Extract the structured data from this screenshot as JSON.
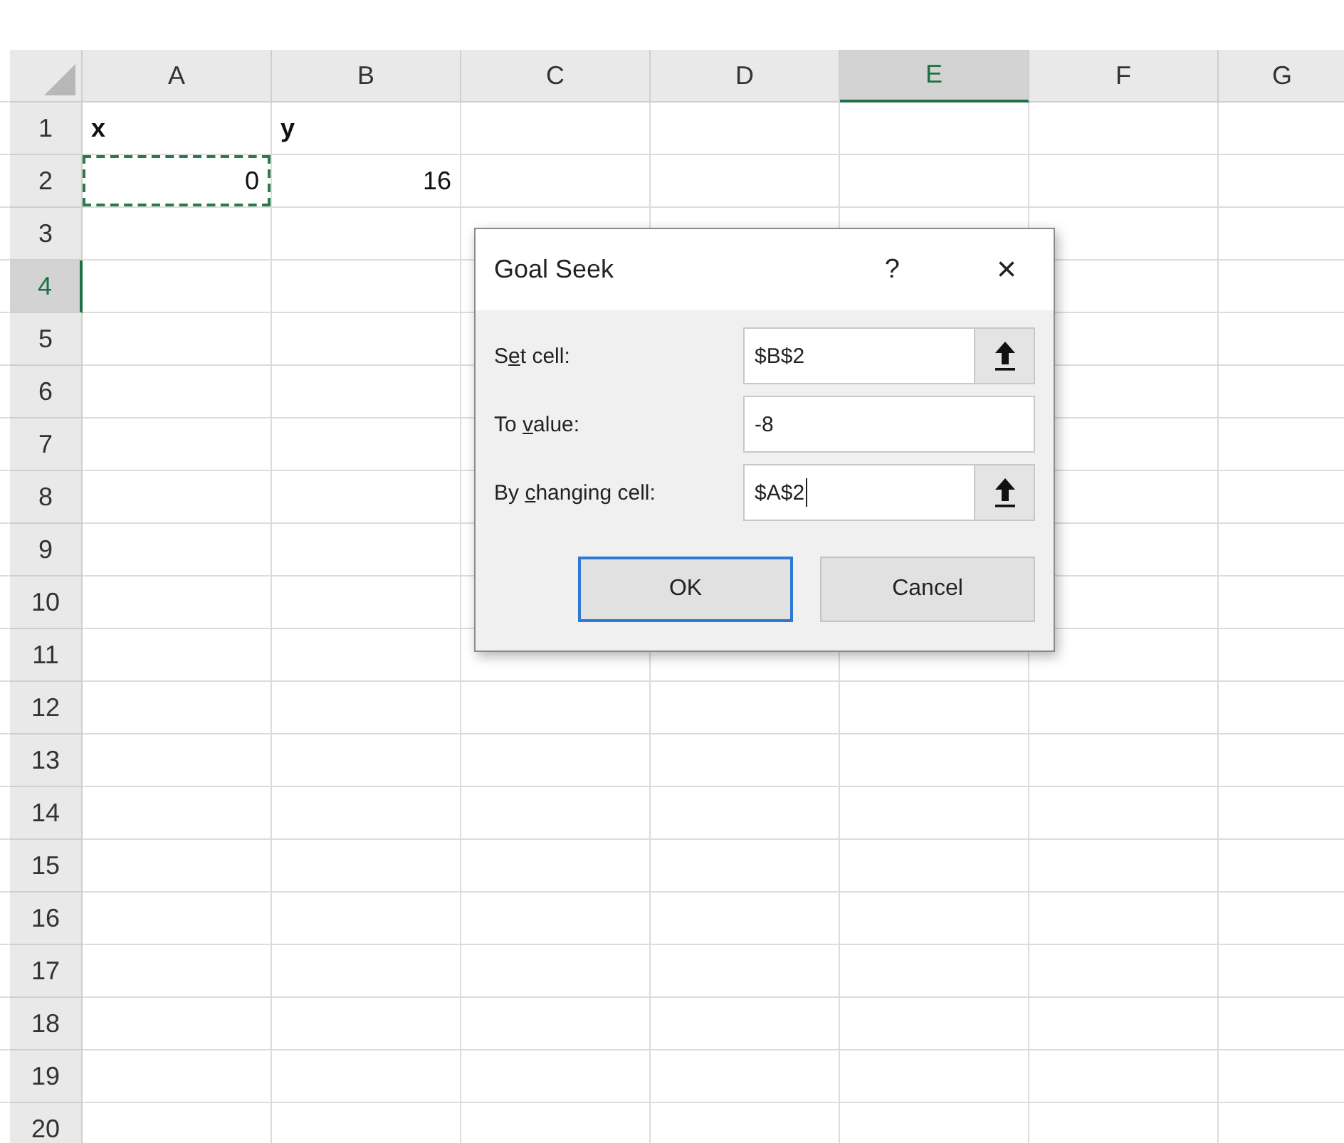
{
  "sheet": {
    "columns": [
      {
        "label": "A",
        "selected": false
      },
      {
        "label": "B",
        "selected": false
      },
      {
        "label": "C",
        "selected": false
      },
      {
        "label": "D",
        "selected": false
      },
      {
        "label": "E",
        "selected": true
      },
      {
        "label": "F",
        "selected": false
      },
      {
        "label": "G",
        "selected": false
      }
    ],
    "rows": [
      {
        "label": "1",
        "selected": false,
        "cells": [
          {
            "kind": "text",
            "text": "x",
            "bold": true
          },
          {
            "kind": "text",
            "text": "y",
            "bold": true
          }
        ]
      },
      {
        "label": "2",
        "selected": false,
        "cells": [
          {
            "kind": "number",
            "text": "0",
            "copy_marquee": true
          },
          {
            "kind": "number",
            "text": "16"
          }
        ]
      },
      {
        "label": "3",
        "selected": false
      },
      {
        "label": "4",
        "selected": true
      },
      {
        "label": "5",
        "selected": false
      },
      {
        "label": "6",
        "selected": false
      },
      {
        "label": "7",
        "selected": false
      },
      {
        "label": "8",
        "selected": false
      },
      {
        "label": "9",
        "selected": false
      },
      {
        "label": "10",
        "selected": false
      },
      {
        "label": "11",
        "selected": false
      },
      {
        "label": "12",
        "selected": false
      },
      {
        "label": "13",
        "selected": false
      },
      {
        "label": "14",
        "selected": false
      },
      {
        "label": "15",
        "selected": false
      },
      {
        "label": "16",
        "selected": false
      },
      {
        "label": "17",
        "selected": false
      },
      {
        "label": "18",
        "selected": false
      },
      {
        "label": "19",
        "selected": false
      },
      {
        "label": "20",
        "selected": false
      }
    ]
  },
  "dialog": {
    "title": "Goal Seek",
    "help": "?",
    "close": "×",
    "fields": [
      {
        "kind": "reference",
        "label": {
          "before": "S",
          "key": "e",
          "after": "t cell:"
        },
        "value": "$B$2",
        "focused": false
      },
      {
        "kind": "plain",
        "label": {
          "before": "To ",
          "key": "v",
          "after": "alue:"
        },
        "value": "-8",
        "focused": false
      },
      {
        "kind": "reference",
        "label": {
          "before": "By ",
          "key": "c",
          "after": "hanging cell:"
        },
        "value": "$A$2",
        "focused": true
      }
    ],
    "buttons": [
      {
        "label": "OK",
        "default": true
      },
      {
        "label": "Cancel",
        "default": false
      }
    ]
  }
}
